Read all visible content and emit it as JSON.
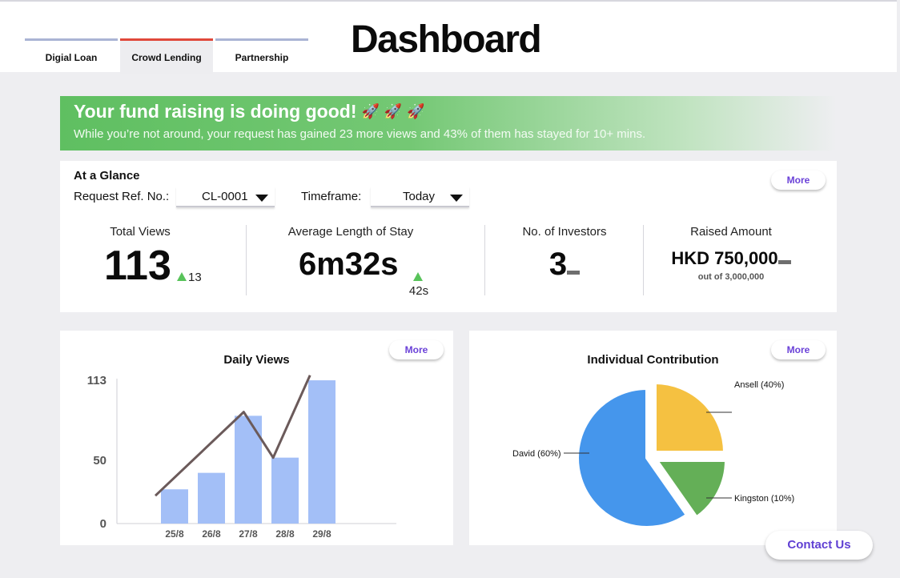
{
  "header": {
    "title": "Dashboard",
    "tabs": [
      {
        "label": "Digial Loan",
        "active": false
      },
      {
        "label": "Crowd Lending",
        "active": true
      },
      {
        "label": "Partnership",
        "active": false
      }
    ]
  },
  "banner": {
    "title": "Your fund raising is doing good!",
    "icons": [
      "rocket-icon",
      "rocket-icon",
      "rocket-icon"
    ],
    "message": "While you’re not around, your request has gained 23 more views and 43% of them has stayed for 10+ mins."
  },
  "glance": {
    "title": "At a Glance",
    "more_label": "More",
    "request_label": "Request Ref. No.:",
    "request_value": "CL-0001",
    "timeframe_label": "Timeframe:",
    "timeframe_value": "Today",
    "metrics": [
      {
        "label": "Total Views",
        "value": "113",
        "delta": "13",
        "trend": "up"
      },
      {
        "label": "Average Length of Stay",
        "value": "6m32s",
        "delta": "42s",
        "trend": "up"
      },
      {
        "label": "No. of Investors",
        "value": "3",
        "trend": "flat"
      },
      {
        "label": "Raised Amount",
        "value": "HKD 750,000",
        "note": "out of 3,000,000",
        "trend": "flat"
      }
    ]
  },
  "daily_views": {
    "title": "Daily Views",
    "more_label": "More"
  },
  "contribution": {
    "title": "Individual Contribution",
    "more_label": "More"
  },
  "contact_label": "Contact Us",
  "colors": {
    "accent": "#6a41d8",
    "active_tab": "#e0483a",
    "tab_inactive": "#aab4d4",
    "bar": "#a3bff7",
    "line": "#6b5a5a",
    "up": "#58c35a",
    "pie_blue": "#4596ec",
    "pie_yellow": "#f5c141",
    "pie_green": "#64af57"
  },
  "chart_data": [
    {
      "type": "bar",
      "title": "Daily Views",
      "categories": [
        "25/8",
        "26/8",
        "27/8",
        "28/8",
        "29/8"
      ],
      "series": [
        {
          "values": [
            27,
            40,
            85,
            52,
            113
          ]
        }
      ],
      "line_values": [
        [
          0,
          22
        ],
        [
          2.4,
          88
        ],
        [
          3.2,
          52
        ],
        [
          4.2,
          117
        ]
      ],
      "yticks": [
        0,
        50,
        113
      ],
      "ylim": [
        0,
        120
      ],
      "grid": false
    },
    {
      "type": "pie",
      "title": "Individual Contribution",
      "slices": [
        {
          "label": "David (60%)",
          "value": 60,
          "color": "#4596ec"
        },
        {
          "label": "Ansell (40%)",
          "value": 30,
          "color": "#f5c141"
        },
        {
          "label": "Kingston (10%)",
          "value": 10,
          "color": "#64af57"
        }
      ]
    }
  ]
}
